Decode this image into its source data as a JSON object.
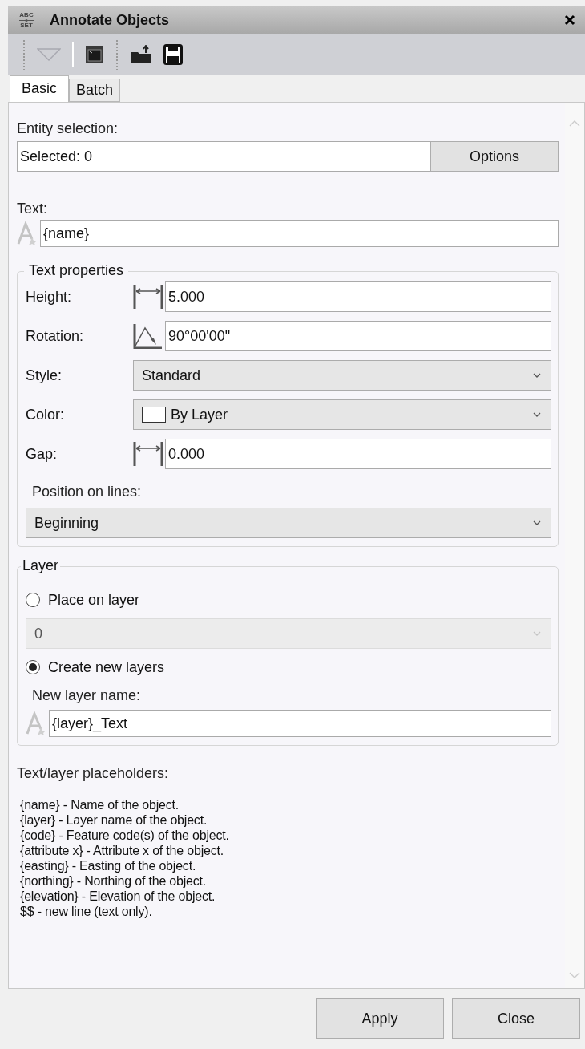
{
  "window": {
    "title": "Annotate Objects",
    "app_icon": {
      "top": "ABC",
      "bottom": "SET"
    }
  },
  "tabs": [
    {
      "label": "Basic",
      "selected": true
    },
    {
      "label": "Batch",
      "selected": false
    }
  ],
  "entity_selection": {
    "label": "Entity selection:",
    "value": "Selected: 0",
    "button": "Options"
  },
  "text": {
    "label": "Text:",
    "value": "{name}"
  },
  "text_properties": {
    "title": "Text properties",
    "rows": [
      {
        "kind": "length",
        "label": "Height:",
        "value": "5.000"
      },
      {
        "kind": "angle",
        "label": "Rotation:",
        "value": "90°00'00\""
      },
      {
        "kind": "select",
        "label": "Style:",
        "value": "Standard"
      },
      {
        "kind": "color",
        "label": "Color:",
        "value": "By Layer"
      },
      {
        "kind": "length",
        "label": "Gap:",
        "value": "0.000"
      }
    ],
    "position": {
      "label": "Position on lines:",
      "value": "Beginning"
    }
  },
  "layer": {
    "title": "Layer",
    "options": [
      {
        "label": "Place on layer",
        "selected": false,
        "dropdown": {
          "value": "0",
          "disabled": true
        }
      },
      {
        "label": "Create new layers",
        "selected": true
      }
    ],
    "name_label": "New layer name:",
    "name_value": "{layer}_Text"
  },
  "placeholders": {
    "title": "Text/layer placeholders:",
    "lines": [
      "{name} - Name of the object.",
      "{layer} - Layer name of the object.",
      "{code} - Feature code(s) of the object.",
      "{attribute x} - Attribute x of the object.",
      "{easting} - Easting of the object.",
      "{northing} - Northing of the object.",
      "{elevation} - Elevation of the object.",
      "$$ - new line (text only)."
    ]
  },
  "buttons": [
    "Apply",
    "Close"
  ]
}
